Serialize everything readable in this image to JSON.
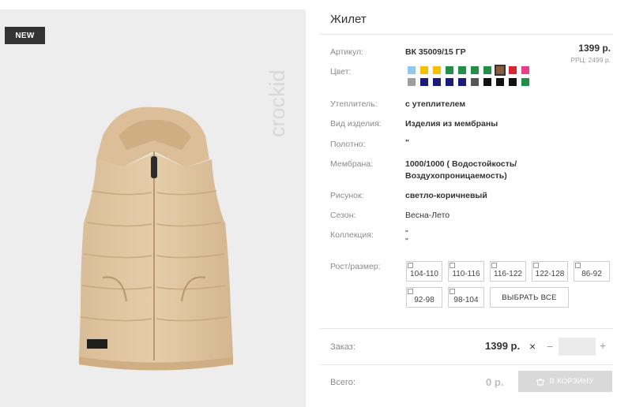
{
  "product": {
    "badge": "NEW",
    "brand": "crockid",
    "title": "Жилет",
    "price": "1399 р.",
    "rrp": "РРЦ: 2499 р."
  },
  "specs": [
    {
      "label": "Артикул:",
      "value": "ВК 35009/15 ГР"
    },
    {
      "label": "Цвет:",
      "value": ""
    },
    {
      "label": "Утеплитель:",
      "value": "с утеплителем"
    },
    {
      "label": "Вид изделия:",
      "value": "Изделия из мембраны"
    },
    {
      "label": "Полотно:",
      "value": "\""
    },
    {
      "label": "Мембрана:",
      "value": "1000/1000 ( Водостойкость/",
      "value2": "Воздухопроницаемость)"
    },
    {
      "label": "Рисунок:",
      "value": "светло-коричневый"
    },
    {
      "label": "Сезон:",
      "value": "Весна-Лето"
    },
    {
      "label": "Коллекция:",
      "value": "\"",
      "value2": "\""
    }
  ],
  "colors": {
    "row1": [
      "#8ec9f0",
      "#f2c200",
      "#f2c200",
      "#1f8f4a",
      "#1f8f4a",
      "#1f8f4a",
      "#1f8f4a",
      "#8a5a3c",
      "#d7262d",
      "#e83e8c"
    ],
    "row2": [
      "#9e9e9e",
      "#1a1a7a",
      "#1a1a7a",
      "#1a1a7a",
      "#1a1a7a",
      "#555555",
      "#111111",
      "#111111",
      "#111111",
      "#1f8f4a"
    ],
    "selected_index_row1": 7
  },
  "sizes": {
    "label": "Рост/размер:",
    "options": [
      "104-110",
      "110-116",
      "116-122",
      "122-128",
      "86-92",
      "92-98",
      "98-104"
    ],
    "select_all": "ВЫБРАТЬ ВСЕ"
  },
  "order": {
    "label": "Заказ:",
    "price": "1399 р.",
    "times": "×",
    "minus": "−",
    "plus": "+",
    "qty": ""
  },
  "total": {
    "label": "Всего:",
    "value": "0 р.",
    "cart_button": "В КОРЗИНУ"
  }
}
